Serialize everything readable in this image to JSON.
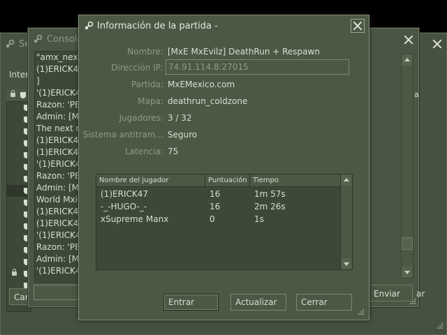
{
  "servers_window": {
    "title": "Se",
    "tab_label": "Inter",
    "connect_label": "Car"
  },
  "console_window": {
    "title": "Consola",
    "lines": [
      "\"amx_next",
      "(1)ERICK47",
      "]",
      "'(1)ERICK4",
      " Razon: 'PE",
      " Admin: [M",
      "The next m",
      "(1)ERICK47",
      "(1)ERICK47",
      "'(1)ERICK4",
      " Razon: 'PE",
      " Admin: [M",
      "World Mxic",
      "(1)ERICK47",
      "(1)ERICK47",
      "'(1)ERICK4",
      " Razon: 'PE",
      " Admin: [M",
      "'(1)ERICK4"
    ],
    "header_fragment": "a",
    "submit_label": "Enviar",
    "right_fragment": "ar"
  },
  "dialog": {
    "title": "Información de la partida -",
    "fields": [
      {
        "label": "Nombre:",
        "value": "[MxE MxEvilz] DeathRun + Respawn"
      },
      {
        "label": "Dirección IP:",
        "value": "74.91.114.8:27015"
      },
      {
        "label": "Partida:",
        "value": "MxEMexico.com"
      },
      {
        "label": "Mapa:",
        "value": "deathrun_coldzone"
      },
      {
        "label": "Jugadores:",
        "value": "3 / 32"
      },
      {
        "label": "Sistema antitram...",
        "value": "Seguro"
      },
      {
        "label": "Latencia:",
        "value": "75"
      }
    ],
    "table": {
      "headers": [
        "Nombre del jugador",
        "Puntuación",
        "Tiempo"
      ],
      "rows": [
        [
          "(1)ERICK47",
          "16",
          "1m 57s"
        ],
        [
          "-_-HUGO-_-",
          "16",
          "2m 26s"
        ],
        [
          "xSupreme Manx",
          "0",
          "1s"
        ]
      ]
    },
    "buttons": {
      "connect": "Entrar",
      "refresh": "Actualizar",
      "close": "Cerrar"
    }
  },
  "colors": {
    "window_bg": "#4c5844",
    "list_bg": "#3e4838",
    "text": "#d8ded3",
    "muted_text": "#8e9986"
  }
}
